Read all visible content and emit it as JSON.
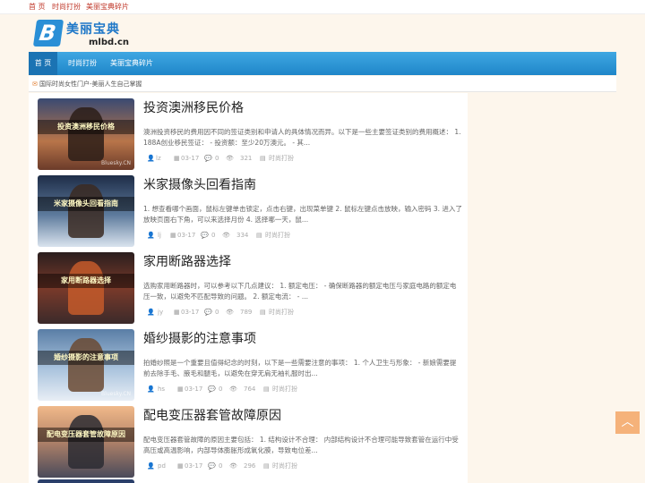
{
  "topbar": {
    "links": [
      "首 页",
      "时尚打扮",
      "美丽宝典碎片"
    ]
  },
  "logo": {
    "letter": "B",
    "cn": "美丽宝典",
    "en": "mlbd.cn"
  },
  "nav": {
    "items": [
      "首 页",
      "时尚打扮",
      "美丽宝典碎片"
    ],
    "active_index": 0
  },
  "breadcrumb": {
    "icon": "mail-icon",
    "text": "国际时尚女性门户-美丽人生自己掌握"
  },
  "colors": {
    "nav": "#2a95d6",
    "accent": "#c0392b",
    "totop": "#f5b27a"
  },
  "posts": [
    {
      "caption": "投资澳洲移民价格",
      "title": "投资澳洲移民价格",
      "excerpt": "澳洲投资移民的费用因不同的签证类别和申请人的具体情况而异。以下是一些主要签证类别的费用概述： 1. 188A创业移民签证： - 投资额：至少20万澳元。 - 其...",
      "author": "lz",
      "date": "03-17",
      "comments": "0",
      "views": "321",
      "category": "时尚打扮"
    },
    {
      "caption": "米家摄像头回看指南",
      "title": "米家摄像头回看指南",
      "excerpt": "1. 想查看哪个画面，鼠标左键单击锁定，点击右键，出现菜单键 2. 鼠标左键点击放映，输入密码 3. 进入了放映页面右下角，可以来选择月份 4. 选择哪一天，鼠...",
      "author": "lj",
      "date": "03-17",
      "comments": "0",
      "views": "334",
      "category": "时尚打扮"
    },
    {
      "caption": "家用断路器选择",
      "title": "家用断路器选择",
      "excerpt": "选购家用断路器时，可以参考以下几点建议： 1. 额定电压： - 确保断路器的额定电压与家庭电路的额定电压一致，以避免不匹配导致的问题。 2. 额定电流： - ...",
      "author": "jy",
      "date": "03-17",
      "comments": "0",
      "views": "789",
      "category": "时尚打扮"
    },
    {
      "caption": "婚纱摄影的注意事项",
      "title": "婚纱摄影的注意事项",
      "excerpt": "拍婚纱照是一个重要且值得纪念的时刻，以下是一些需要注意的事项： 1. 个人卫生与形象： - 新娘需要提前去除手毛、腋毛和腿毛，以避免在穿无肩无袖礼服时出...",
      "author": "hs",
      "date": "03-17",
      "comments": "0",
      "views": "764",
      "category": "时尚打扮"
    },
    {
      "caption": "配电变压器套管故障原因",
      "title": "配电变压器套管故障原因",
      "excerpt": "配电变压器套管故障的原因主要包括： 1. 结构设计不合理： 内部结构设计不合理可能导致套管在运行中受高压或高温影响，内部导体膨胀形成氧化膜，导致电位差...",
      "author": "pd",
      "date": "03-17",
      "comments": "0",
      "views": "296",
      "category": "时尚打扮"
    }
  ],
  "thumb_watermark": "Bluesky.CN",
  "totop": {
    "icon": "chevron-up-icon",
    "glyph": "︿"
  }
}
